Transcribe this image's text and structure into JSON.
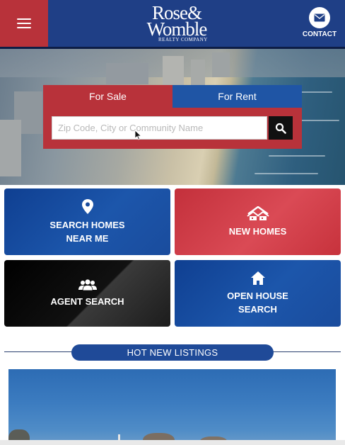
{
  "header": {
    "menu_icon": "hamburger-icon",
    "logo": {
      "line1": "Rose&",
      "line2": "Womble",
      "line3": "REALTY COMPANY"
    },
    "contact": {
      "icon": "envelope-icon",
      "label": "CONTACT"
    }
  },
  "search": {
    "tabs": [
      {
        "label": "For Sale",
        "active": true
      },
      {
        "label": "For Rent",
        "active": false
      }
    ],
    "placeholder": "Zip Code, City or Community Name",
    "value": "",
    "button_icon": "search-icon"
  },
  "tiles": [
    {
      "line1": "SEARCH HOMES",
      "line2": "NEAR ME",
      "icon": "location-pin-icon",
      "color": "#1b4fa0"
    },
    {
      "line1": "NEW HOMES",
      "line2": "",
      "icon": "houses-icon",
      "color": "#cc3a45"
    },
    {
      "line1": "AGENT SEARCH",
      "line2": "",
      "icon": "people-icon",
      "color": "#000000"
    },
    {
      "line1": "OPEN HOUSE",
      "line2": "SEARCH",
      "icon": "house-icon",
      "color": "#1b4fa0"
    }
  ],
  "hot_listings": {
    "label": "HOT NEW LISTINGS"
  },
  "colors": {
    "brand_blue": "#1f3f86",
    "brand_red": "#b8323a",
    "pill_blue": "#1f4a98"
  }
}
